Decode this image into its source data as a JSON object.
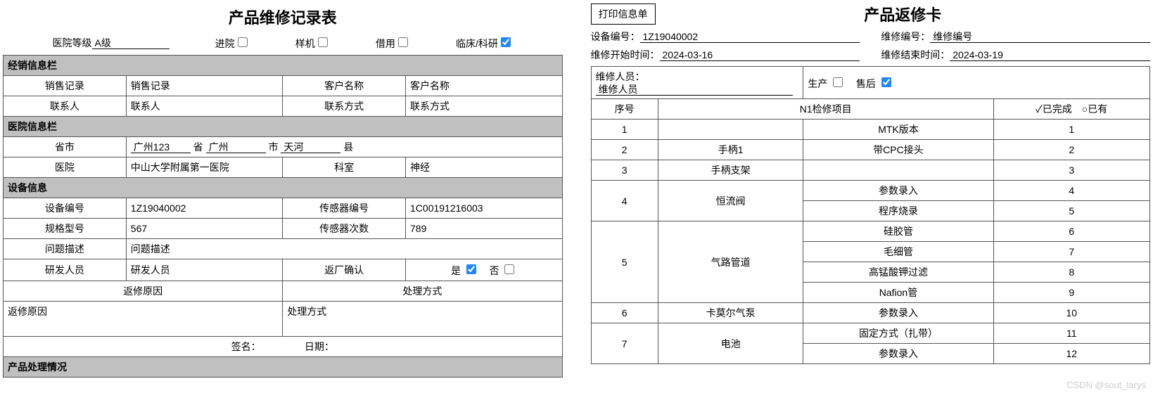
{
  "left": {
    "title": "产品维修记录表",
    "hosp_level_label": "医院等级",
    "hosp_level_value": "A级",
    "entry_label": "进院",
    "entry_checked": false,
    "sample_label": "样机",
    "sample_checked": false,
    "borrow_label": "借用",
    "borrow_checked": false,
    "clinical_label": "临床/科研",
    "clinical_checked": true,
    "sec_dealer": "经销信息栏",
    "sales_record_h": "销售记录",
    "sales_record_v": "销售记录",
    "cust_name_h": "客户名称",
    "cust_name_v": "客户名称",
    "contact_h": "联系人",
    "contact_v": "联系人",
    "phone_h": "联系方式",
    "phone_v": "联系方式",
    "sec_hosp": "医院信息栏",
    "prov_city_h": "省市",
    "prov_value": "广州123",
    "prov_label": "省",
    "city_value": "广州",
    "city_label": "市",
    "county_value": "天河",
    "county_label": "县",
    "hosp_h": "医院",
    "hosp_v": "中山大学附属第一医院",
    "dept_h": "科室",
    "dept_v": "神经",
    "sec_device": "设备信息",
    "dev_no_h": "设备编号",
    "dev_no_v": "1Z19040002",
    "sensor_no_h": "传感器编号",
    "sensor_no_v": "1C00191216003",
    "spec_h": "规格型号",
    "spec_v": "567",
    "sensor_cnt_h": "传感器次数",
    "sensor_cnt_v": "789",
    "issue_h": "问题描述",
    "issue_v": "问题描述",
    "rd_h": "研发人员",
    "rd_v": "研发人员",
    "return_confirm_h": "返厂确认",
    "yes_label": "是",
    "yes_checked": true,
    "no_label": "否",
    "no_checked": false,
    "reason_h": "返修原因",
    "handle_h": "处理方式",
    "reason_v": "返修原因",
    "handle_v": "处理方式",
    "sign_label": "签名：",
    "date_label": "日期：",
    "sec_product": "产品处理情况"
  },
  "right": {
    "print_btn": "打印信息单",
    "title": "产品返修卡",
    "dev_no_label": "设备编号：",
    "dev_no_value": "1Z19040002",
    "repair_no_label": "维修编号：",
    "repair_no_value": "维修编号",
    "start_label": "维修开始时间：",
    "start_value": "2024-03-16",
    "end_label": "维修结束时间：",
    "end_value": "2024-03-19",
    "staff_label": "维修人员：",
    "staff_value": "维修人员",
    "produce_label": "生产",
    "produce_checked": false,
    "after_label": "售后",
    "after_checked": true,
    "col_seq": "序号",
    "col_item": "N1检修项目",
    "col_status": "✓已完成　○已有",
    "rows": [
      {
        "seq": "1",
        "item": "",
        "sub": "MTK版本",
        "status": "1",
        "rowspan": 1
      },
      {
        "seq": "2",
        "item": "手柄1",
        "sub": "带CPC接头",
        "status": "2",
        "rowspan": 1
      },
      {
        "seq": "3",
        "item": "手柄支架",
        "sub": "",
        "status": "3",
        "rowspan": 1
      },
      {
        "seq": "4",
        "item": "恒流阀",
        "sub": "参数录入",
        "status": "4",
        "rowspan": 2
      },
      {
        "sub": "程序烧录",
        "status": "5"
      },
      {
        "seq": "5",
        "item": "气路管道",
        "sub": "硅胶管",
        "status": "6",
        "rowspan": 4
      },
      {
        "sub": "毛细管",
        "status": "7"
      },
      {
        "sub": "高锰酸钾过滤",
        "status": "8"
      },
      {
        "sub": "Nafion管",
        "status": "9"
      },
      {
        "seq": "6",
        "item": "卡莫尔气泵",
        "sub": "参数录入",
        "status": "10",
        "rowspan": 1
      },
      {
        "seq": "7",
        "item": "电池",
        "sub": "固定方式（扎带）",
        "status": "11",
        "rowspan": 2
      },
      {
        "sub": "参数录入",
        "status": "12"
      }
    ]
  },
  "watermark": "CSDN @sout_larys"
}
